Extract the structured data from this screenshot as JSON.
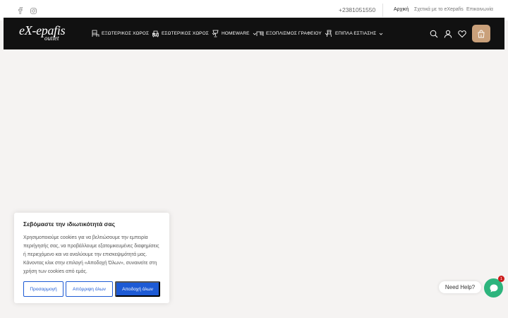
{
  "topbar": {
    "social": [
      {
        "name": "facebook-icon"
      },
      {
        "name": "instagram-icon"
      }
    ],
    "phone": "+2381051550",
    "links": [
      {
        "label": "Αρχική",
        "active": true
      },
      {
        "label": "Σχετικά με το eXepafis",
        "active": false
      },
      {
        "label": "Επικοινωνία",
        "active": false
      }
    ]
  },
  "header": {
    "logo": {
      "line1": "eX-epafis",
      "line2": "outlet"
    },
    "nav": [
      {
        "label": "ΕΞΩΤΕΡΙΚΟΣ ΧΩΡΟΣ",
        "icon": "outdoor-furniture-icon"
      },
      {
        "label": "ΕΣΩΤΕΡΙΚΟΣ ΧΩΡΟΣ",
        "icon": "armchair-icon"
      },
      {
        "label": "HOMEWARE",
        "icon": "lamp-icon"
      },
      {
        "label": "ΕΞΟΠΛΙΣΜΟΣ ΓΡΑΦΕΙΟΥ",
        "icon": "desk-icon"
      },
      {
        "label": "ΕΠΙΠΛΑ ΕΣΤΙΑΣΗΣ",
        "icon": "bar-stool-icon"
      }
    ],
    "icons": [
      "search-icon",
      "user-icon",
      "heart-icon",
      "bag-icon"
    ],
    "cart_count": "0"
  },
  "cookie": {
    "title": "Σεβόμαστε την ιδιωτικότητά σας",
    "body": "Χρησιμοποιούμε cookies για να βελτιώσουμε την εμπειρία περιήγησής σας, να προβάλλουμε εξατομικευμένες διαφημίσεις ή περιεχόμενο και να αναλύουμε την επισκεψιμότητά μας. Κάνοντας κλικ στην επιλογή «Αποδοχή Όλων», συναινείτε στη χρήση των cookies από εμάς.",
    "buttons": {
      "customize": "Προσαρμογή",
      "reject": "Απόρριψη όλων",
      "accept": "Αποδοχή όλων"
    }
  },
  "chat": {
    "need_help": "Need Help?",
    "badge": "1"
  },
  "colors": {
    "header_bg": "#111111",
    "cart_accent": "#c9a07a",
    "cookie_blue": "#1d5ad4",
    "chat_green": "#2db47d",
    "page_bg": "#f5f3f2"
  }
}
